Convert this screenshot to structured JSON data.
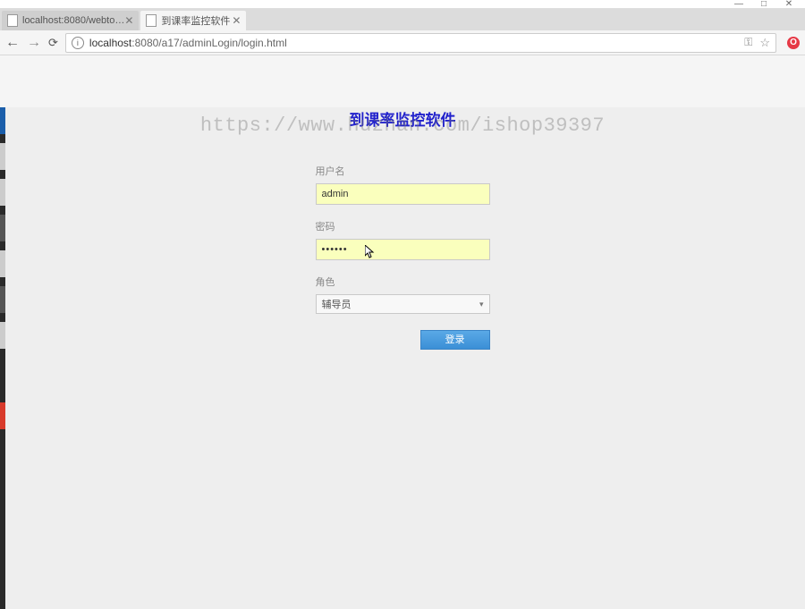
{
  "window": {
    "controls": {
      "min": "—",
      "max": "□",
      "close": "✕"
    }
  },
  "tabs": {
    "items": [
      {
        "title": "localhost:8080/webto…",
        "close": "✕"
      },
      {
        "title": "到课率监控软件",
        "close": "✕"
      }
    ],
    "new_tab": ""
  },
  "addressBar": {
    "back": "←",
    "forward": "→",
    "reload": "⟳",
    "info": "i",
    "host": "localhost",
    "path": ":8080/a17/adminLogin/login.html",
    "key": "⚿",
    "star": "☆",
    "adblock": "O"
  },
  "watermark": "https://www.huzhan.com/ishop39397",
  "page": {
    "title": "到课率监控软件",
    "form": {
      "username_label": "用户名",
      "username_value": "admin",
      "password_label": "密码",
      "password_value": "••••••",
      "role_label": "角色",
      "role_value": "辅导员",
      "submit_label": "登录"
    }
  }
}
